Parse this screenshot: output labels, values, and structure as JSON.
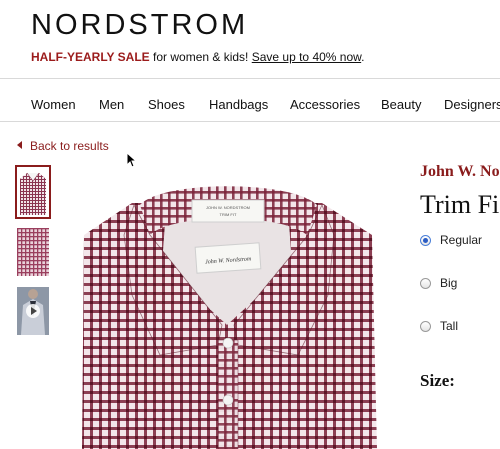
{
  "header": {
    "logo": "NORDSTROM",
    "promo": {
      "sale": "HALF-YEARLY SALE",
      "text": " for women & kids! ",
      "link": "Save up to 40% now",
      "end": "."
    }
  },
  "nav": {
    "items": [
      "Women",
      "Men",
      "Shoes",
      "Handbags",
      "Accessories",
      "Beauty",
      "Designers"
    ]
  },
  "product": {
    "back_link": "Back to results",
    "brand": "John W. No",
    "title": "Trim Fi",
    "fit_options": [
      {
        "label": "Regular",
        "selected": true
      },
      {
        "label": "Big",
        "selected": false
      },
      {
        "label": "Tall",
        "selected": false
      }
    ],
    "size_label": "Size:"
  },
  "image": {
    "collar_label_1": "JOHN W. NORDSTROM",
    "collar_label_2": "TRIM FIT",
    "collar_signature": "John W. Nordstrom"
  },
  "colors": {
    "brand_red": "#8a1c1c",
    "sale_red": "#9b1b1b",
    "shirt_check": "#7a2238"
  },
  "icons": [
    "back-arrow-icon",
    "mouse-cursor-icon",
    "play-icon",
    "radio-icon"
  ]
}
